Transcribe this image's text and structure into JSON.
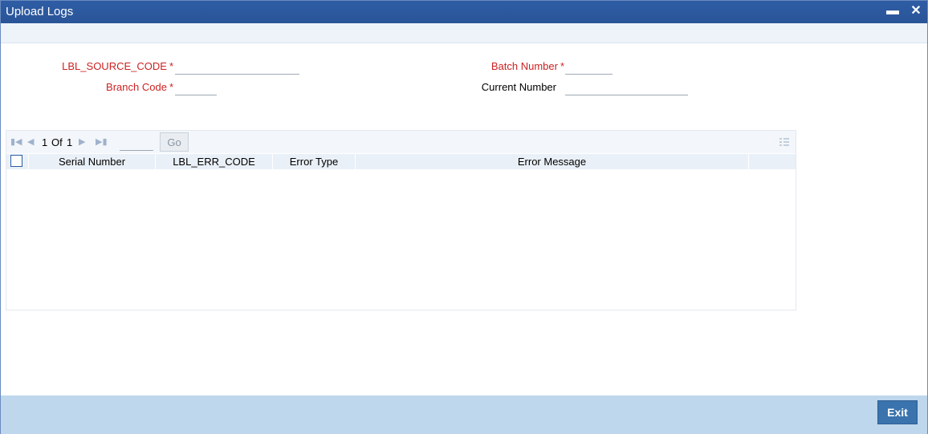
{
  "window": {
    "title": "Upload Logs",
    "minimize_glyph": "▬",
    "close_glyph": "✕"
  },
  "form": {
    "source_code_label": "LBL_SOURCE_CODE",
    "source_code_value": "",
    "branch_code_label": "Branch Code",
    "branch_code_value": "",
    "batch_number_label": "Batch Number",
    "batch_number_value": "",
    "current_number_label": "Current Number",
    "current_number_value": "",
    "required_marker": "*"
  },
  "grid": {
    "pager": {
      "current_page": "1",
      "of_label": "Of",
      "total_pages": "1",
      "page_input_value": "",
      "go_label": "Go"
    },
    "columns": [
      "Serial Number",
      "LBL_ERR_CODE",
      "Error Type",
      "Error Message"
    ],
    "rows": []
  },
  "footer": {
    "exit_label": "Exit"
  },
  "colors": {
    "titlebar": "#2a5498",
    "required": "#cc2222",
    "footer": "#bed7ec",
    "exit_button": "#3a73ad"
  },
  "icons": {
    "first_page": "first-page-icon",
    "prev_page": "prev-page-icon",
    "next_page": "next-page-icon",
    "last_page": "last-page-icon",
    "columns": "column-settings-icon"
  }
}
